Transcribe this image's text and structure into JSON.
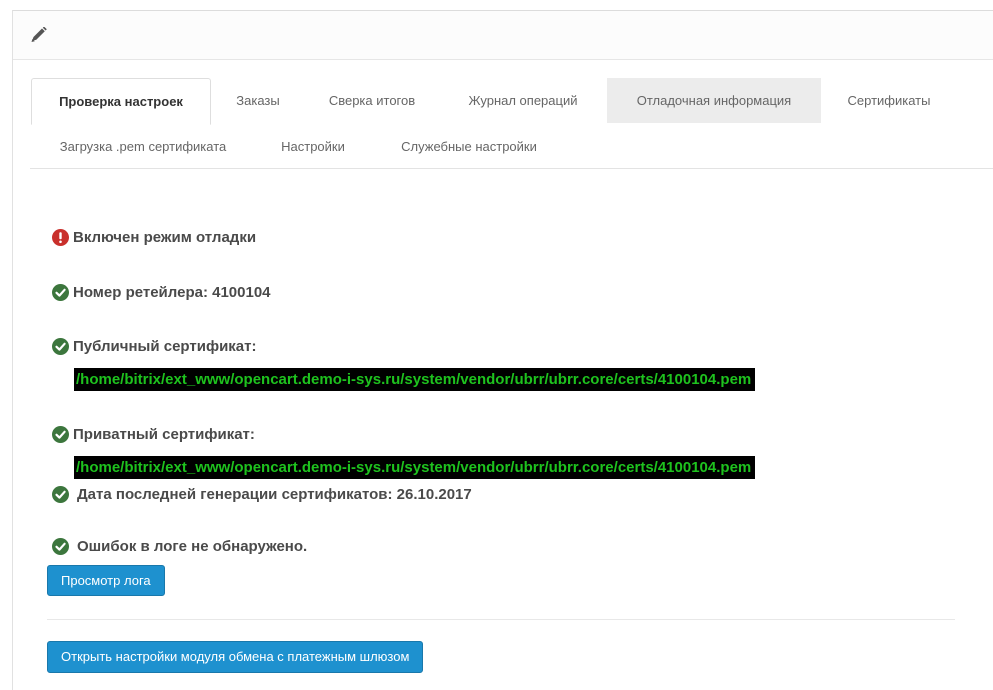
{
  "tabs_row1": [
    {
      "label": "Проверка настроек",
      "state": "active"
    },
    {
      "label": "Заказы",
      "state": "normal"
    },
    {
      "label": "Сверка итогов",
      "state": "normal"
    },
    {
      "label": "Журнал операций",
      "state": "normal"
    },
    {
      "label": "Отладочная информация",
      "state": "hover"
    },
    {
      "label": "Сертификаты",
      "state": "normal"
    }
  ],
  "tabs_row2": [
    {
      "label": "Загрузка .pem сертификата"
    },
    {
      "label": "Настройки"
    },
    {
      "label": "Служебные настройки"
    }
  ],
  "checks": {
    "debug": "Включен режим отладки",
    "retailer": "Номер ретейлера: 4100104",
    "public_cert": "Публичный сертификат:",
    "public_cert_path": "/home/bitrix/ext_www/opencart.demo-i-sys.ru/system/vendor/ubrr/ubrr.core/certs/4100104.pem",
    "private_cert": "Приватный сертификат:",
    "private_cert_path": "/home/bitrix/ext_www/opencart.demo-i-sys.ru/system/vendor/ubrr/ubrr.core/certs/4100104.pem",
    "generation_date": "Дата последней генерации сертификатов: 26.10.2017",
    "log_errors": "Ошибок в логе не обнаружено."
  },
  "buttons": {
    "view_log": "Просмотр лога",
    "open_settings": "Открыть настройки модуля обмена с платежным шлюзом"
  },
  "icons": {
    "heading": "pencil-icon",
    "error": "exclamation-circle-icon",
    "ok": "check-circle-icon"
  },
  "colors": {
    "error": "#c9302c",
    "ok": "#3c763d",
    "path_text": "#1ec21e",
    "path_bg": "#000000",
    "button": "#1e91cf"
  }
}
